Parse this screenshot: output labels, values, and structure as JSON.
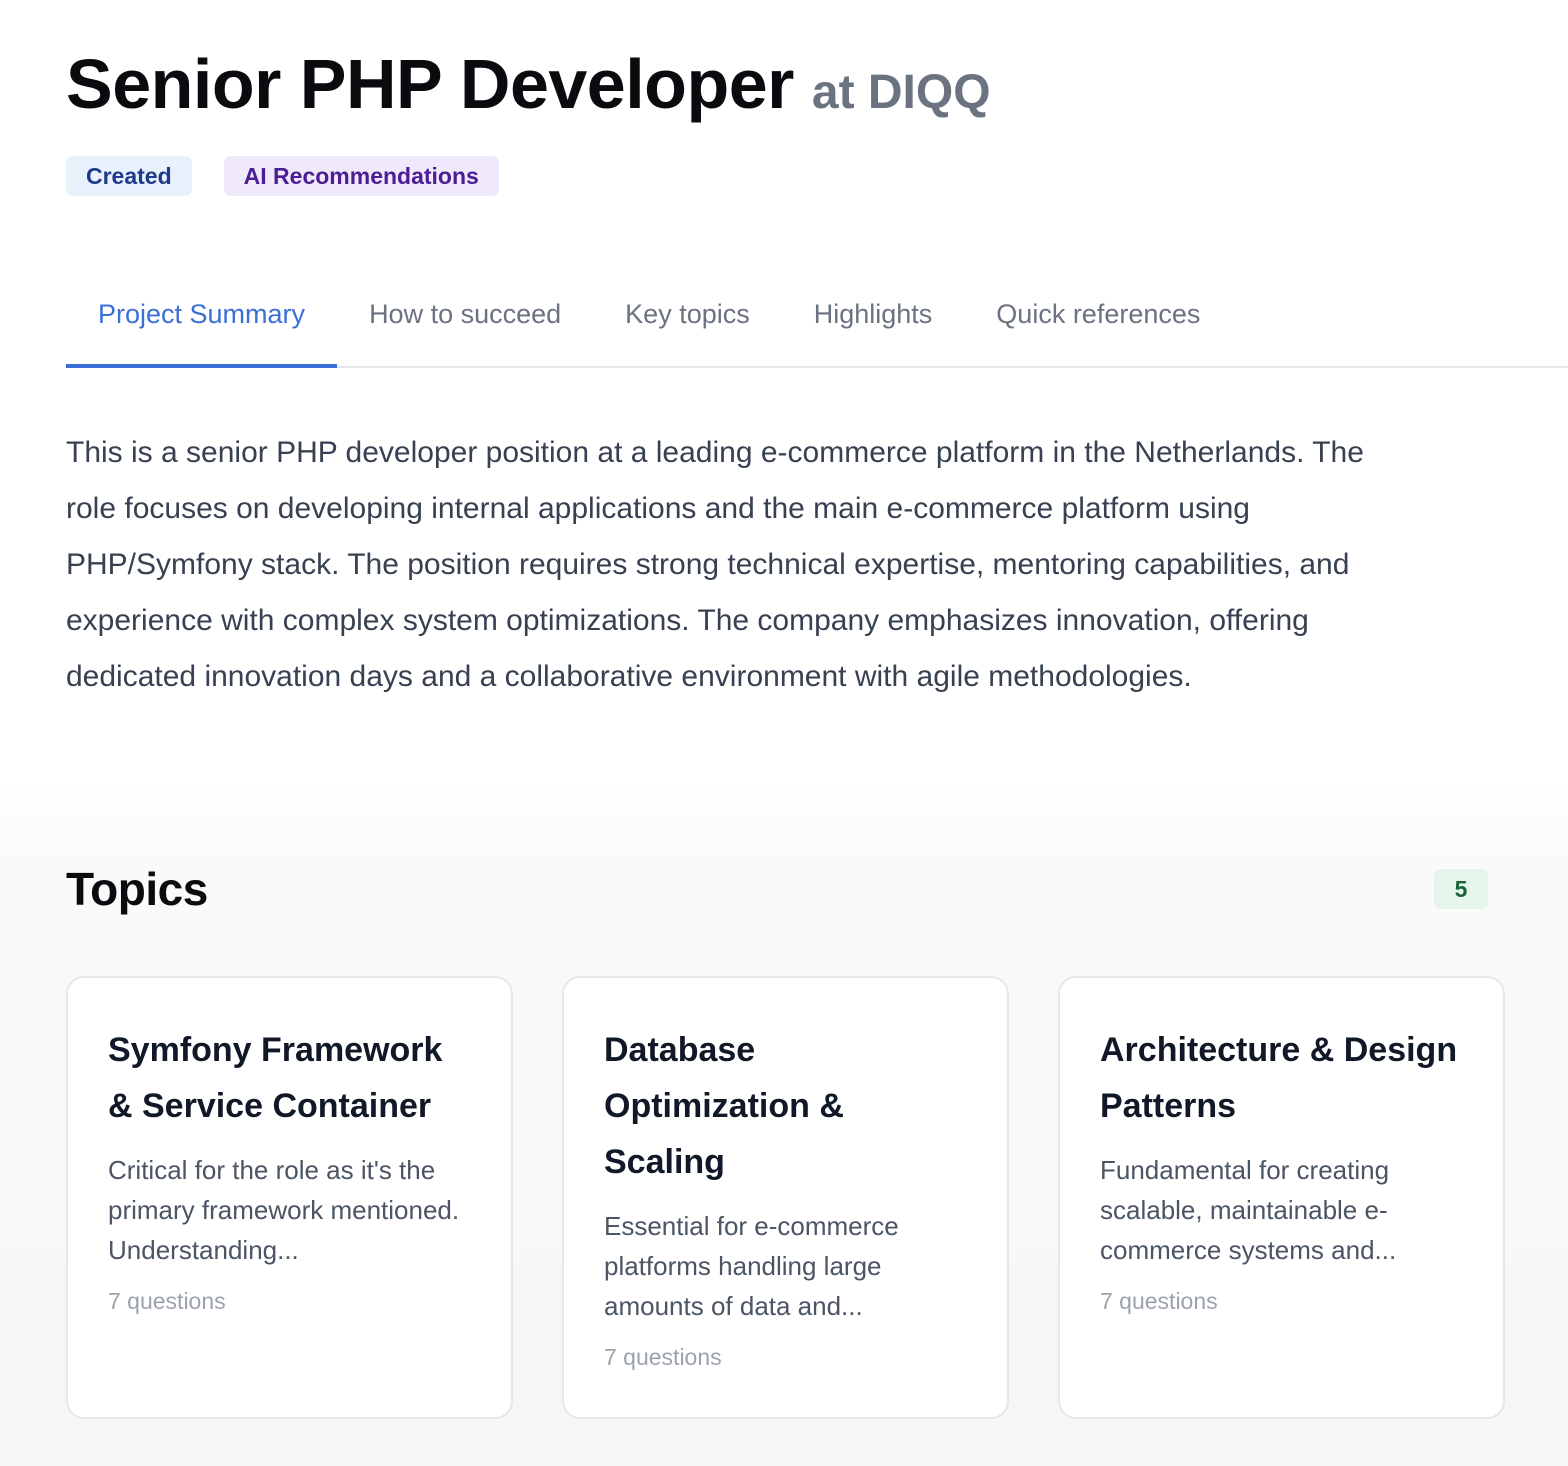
{
  "header": {
    "title": "Senior PHP Developer",
    "company": "at DIQQ"
  },
  "badges": {
    "created": "Created",
    "ai": "AI Recommendations"
  },
  "tabs": [
    {
      "label": "Project Summary",
      "active": true
    },
    {
      "label": "How to succeed",
      "active": false
    },
    {
      "label": "Key topics",
      "active": false
    },
    {
      "label": "Highlights",
      "active": false
    },
    {
      "label": "Quick references",
      "active": false
    }
  ],
  "summary": "This is a senior PHP developer position at a leading e-commerce platform in the Netherlands. The role focuses on developing internal applications and the main e-commerce platform using PHP/Symfony stack. The position requires strong technical expertise, mentoring capabilities, and experience with complex system optimizations. The company emphasizes innovation, offering dedicated innovation days and a collaborative environment with agile methodologies.",
  "topics": {
    "title": "Topics",
    "count": "5",
    "items": [
      {
        "title": "Symfony Framework & Service Container",
        "description": "Critical for the role as it's the primary framework mentioned. Understanding...",
        "meta": "7 questions"
      },
      {
        "title": "Database Optimization & Scaling",
        "description": "Essential for e-commerce platforms handling large amounts of data and...",
        "meta": "7 questions"
      },
      {
        "title": "Architecture & Design Patterns",
        "description": "Fundamental for creating scalable, maintainable e-commerce systems and...",
        "meta": "7 questions"
      }
    ]
  },
  "colors": {
    "accent": "#3b6fd8",
    "created_badge_bg": "#e8f1fc",
    "ai_badge_bg": "#efe9fb",
    "count_badge_bg": "#e6f5ea"
  }
}
